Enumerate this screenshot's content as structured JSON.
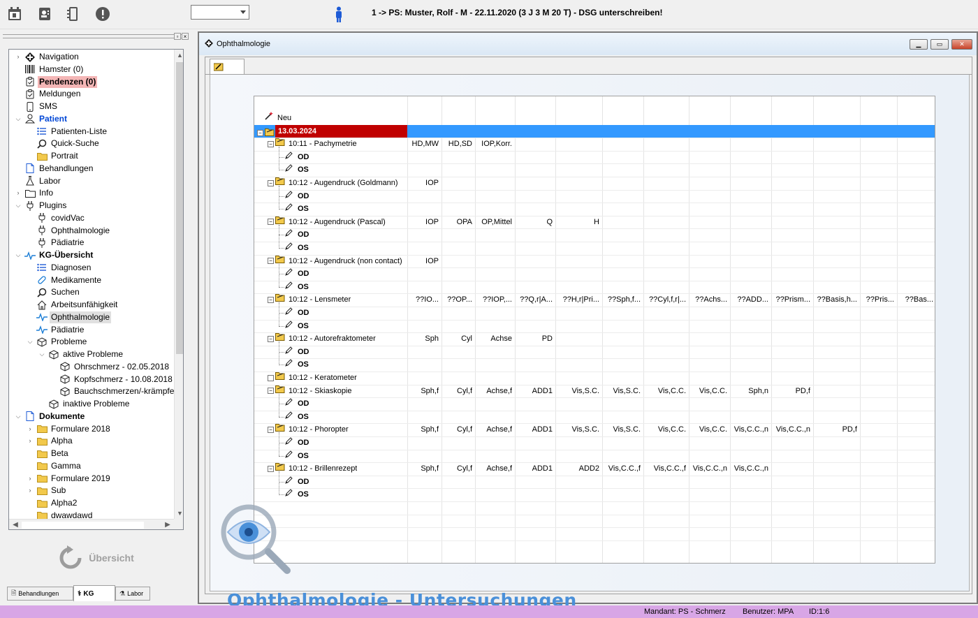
{
  "topbar": {
    "icons": [
      "calendar-icon",
      "contact-card-icon",
      "list-icon",
      "alert-icon"
    ],
    "select_value": "",
    "patient_text": "1 -> PS: Muster, Rolf - M - 22.11.2020 (3 J 3 M 20 T) - DSG unterschreiben!"
  },
  "sidebar": {
    "items": [
      {
        "label": "Navigation",
        "icon": "navigation-icon",
        "indent": 0,
        "exp": ">"
      },
      {
        "label": "Hamster (0)",
        "icon": "barcode-icon",
        "indent": 0,
        "exp": ""
      },
      {
        "label": "Pendenzen (0)",
        "icon": "clipboard-icon",
        "indent": 0,
        "exp": ""
      },
      {
        "label": "Meldungen",
        "icon": "clipboard-icon",
        "indent": 0,
        "exp": ""
      },
      {
        "label": "SMS",
        "icon": "phone-icon",
        "indent": 0,
        "exp": ""
      },
      {
        "label": "Patient",
        "icon": "person-icon",
        "indent": 0,
        "exp": "v"
      },
      {
        "label": "Patienten-Liste",
        "icon": "list-icon",
        "indent": 1,
        "exp": ""
      },
      {
        "label": "Quick-Suche",
        "icon": "search-icon",
        "indent": 1,
        "exp": ""
      },
      {
        "label": "Portrait",
        "icon": "folder-icon",
        "indent": 1,
        "exp": ""
      },
      {
        "label": "Behandlungen",
        "icon": "document-icon",
        "indent": 0,
        "exp": ""
      },
      {
        "label": "Labor",
        "icon": "flask-icon",
        "indent": 0,
        "exp": ""
      },
      {
        "label": "Info",
        "icon": "folder-outline-icon",
        "indent": 0,
        "exp": ">"
      },
      {
        "label": "Plugins",
        "icon": "plug-icon",
        "indent": 0,
        "exp": "v"
      },
      {
        "label": "covidVac",
        "icon": "plug-icon",
        "indent": 1,
        "exp": ""
      },
      {
        "label": "Ophthalmologie",
        "icon": "plug-icon",
        "indent": 1,
        "exp": ""
      },
      {
        "label": "Pädiatrie",
        "icon": "plug-icon",
        "indent": 1,
        "exp": ""
      },
      {
        "label": "KG-Übersicht",
        "icon": "pulse-icon",
        "indent": 0,
        "exp": "v"
      },
      {
        "label": "Diagnosen",
        "icon": "list-icon",
        "indent": 1,
        "exp": ""
      },
      {
        "label": "Medikamente",
        "icon": "pill-icon",
        "indent": 1,
        "exp": ""
      },
      {
        "label": "Suchen",
        "icon": "search-icon",
        "indent": 1,
        "exp": ""
      },
      {
        "label": "Arbeitsunfähigkeit",
        "icon": "house-icon",
        "indent": 1,
        "exp": ""
      },
      {
        "label": "Ophthalmologie",
        "icon": "pulse-icon",
        "indent": 1,
        "exp": ""
      },
      {
        "label": "Pädiatrie",
        "icon": "pulse-icon",
        "indent": 1,
        "exp": ""
      },
      {
        "label": "Probleme",
        "icon": "box-icon",
        "indent": 1,
        "exp": "v"
      },
      {
        "label": "aktive Probleme",
        "icon": "box-icon",
        "indent": 2,
        "exp": "v"
      },
      {
        "label": "Ohrschmerz - 02.05.2018",
        "icon": "box-icon",
        "indent": 3,
        "exp": ""
      },
      {
        "label": "Kopfschmerz - 10.08.2018",
        "icon": "box-icon",
        "indent": 3,
        "exp": ""
      },
      {
        "label": "Bauchschmerzen/-krämpfe,",
        "icon": "box-icon",
        "indent": 3,
        "exp": ""
      },
      {
        "label": "inaktive Probleme",
        "icon": "box-icon",
        "indent": 2,
        "exp": ""
      },
      {
        "label": "Dokumente",
        "icon": "document-icon",
        "indent": 0,
        "exp": "v"
      },
      {
        "label": "Formulare 2018",
        "icon": "folder-icon",
        "indent": 1,
        "exp": ">"
      },
      {
        "label": "Alpha",
        "icon": "folder-icon",
        "indent": 1,
        "exp": ">"
      },
      {
        "label": "Beta",
        "icon": "folder-icon",
        "indent": 1,
        "exp": ""
      },
      {
        "label": "Gamma",
        "icon": "folder-icon",
        "indent": 1,
        "exp": ""
      },
      {
        "label": "Formulare 2019",
        "icon": "folder-icon",
        "indent": 1,
        "exp": ">"
      },
      {
        "label": "Sub",
        "icon": "folder-icon",
        "indent": 1,
        "exp": ">"
      },
      {
        "label": "Alpha2",
        "icon": "folder-icon",
        "indent": 1,
        "exp": ""
      },
      {
        "label": "dwawdawd",
        "icon": "folder-icon",
        "indent": 1,
        "exp": ""
      }
    ],
    "overview_label": "Übersicht",
    "tabs": [
      "Behandlungen",
      "KG",
      "Labor"
    ]
  },
  "window": {
    "title": "Ophthalmologie",
    "watermark_title": "Ophthalmologie - Untersuchungen"
  },
  "grid": {
    "new_label": "Neu",
    "date": "13.03.2024",
    "sub_labels": [
      "OD",
      "OS"
    ],
    "groups": [
      {
        "label": "10:11 - Pachymetrie",
        "values": [
          "HD,MW",
          "HD,SD",
          "IOP,Korr."
        ],
        "subs": true
      },
      {
        "label": "10:12 - Augendruck (Goldmann)",
        "values": [
          "IOP"
        ],
        "subs": true
      },
      {
        "label": "10:12 - Augendruck (Pascal)",
        "values": [
          "IOP",
          "OPA",
          "OP,Mittel",
          "Q",
          "H"
        ],
        "subs": true
      },
      {
        "label": "10:12 - Augendruck (non contact)",
        "values": [
          "IOP"
        ],
        "subs": true
      },
      {
        "label": "10:12 - Lensmeter",
        "values": [
          "??IO...",
          "??OP...",
          "??IOP,...",
          "??Q,r|A...",
          "??H,r|Pri...",
          "??Sph,f...",
          "??Cyl,f,r|...",
          "??Achs...",
          "??ADD...",
          "??Prism...",
          "??Basis,h...",
          "??Pris...",
          "??Bas..."
        ],
        "subs": true
      },
      {
        "label": "10:12 - Autorefraktometer",
        "values": [
          "Sph",
          "Cyl",
          "Achse",
          "PD"
        ],
        "subs": true
      },
      {
        "label": "10:12 - Keratometer",
        "values": [],
        "subs": false
      },
      {
        "label": "10:12 - Skiaskopie",
        "values": [
          "Sph,f",
          "Cyl,f",
          "Achse,f",
          "ADD1",
          "Vis,S.C.",
          "Vis,S.C.",
          "Vis,C.C.",
          "Vis,C.C.",
          "Sph,n",
          "PD,f"
        ],
        "subs": true
      },
      {
        "label": "10:12 - Phoropter",
        "values": [
          "Sph,f",
          "Cyl,f",
          "Achse,f",
          "ADD1",
          "Vis,S.C.",
          "Vis,S.C.",
          "Vis,C.C.",
          "Vis,C.C.",
          "Vis,C.C.,n",
          "Vis,C.C.,n",
          "PD,f"
        ],
        "subs": true
      },
      {
        "label": "10:12 - Brillenrezept",
        "values": [
          "Sph,f",
          "Cyl,f",
          "Achse,f",
          "ADD1",
          "ADD2",
          "Vis,C.C.,f",
          "Vis,C.C.,f",
          "Vis,C.C.,n",
          "Vis,C.C.,n"
        ],
        "subs": true
      }
    ]
  },
  "statusbar": {
    "mandant": "Mandant: PS - Schmerz",
    "benutzer": "Benutzer: MPA",
    "id": "ID:1:6"
  },
  "colors": {
    "date_highlight": "#c00000",
    "row_highlight": "#3399ff",
    "pending_bg": "#f4b6b6",
    "statusbar_bg": "#d8a6e6",
    "watermark": "#4a90d9"
  }
}
